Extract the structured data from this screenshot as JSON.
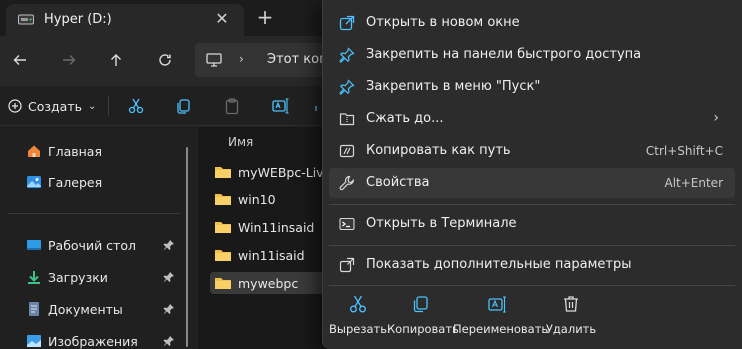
{
  "tab": {
    "title": "Hyper (D:)",
    "close_glyph": "✕",
    "new_glyph": "+"
  },
  "nav": {
    "back": "back-arrow-icon",
    "forward": "forward-arrow-icon",
    "up": "up-arrow-icon",
    "refresh": "refresh-icon"
  },
  "address": {
    "chevron": "›",
    "text": "Этот ком"
  },
  "commandbar": {
    "create_label": "Создать",
    "create_chevron": "⌄"
  },
  "sidebar": {
    "items": [
      {
        "label": "Главная",
        "icon": "home-icon"
      },
      {
        "label": "Галерея",
        "icon": "gallery-icon"
      },
      {
        "label": "Рабочий стол",
        "icon": "desktop-icon",
        "pinned": true
      },
      {
        "label": "Загрузки",
        "icon": "downloads-icon",
        "pinned": true
      },
      {
        "label": "Документы",
        "icon": "documents-icon",
        "pinned": true
      },
      {
        "label": "Изображения",
        "icon": "pictures-icon",
        "pinned": true
      }
    ]
  },
  "filelist": {
    "column_name": "Имя",
    "rows": [
      {
        "name": "myWEBpc-LiveC"
      },
      {
        "name": "win10"
      },
      {
        "name": "Win11insaid"
      },
      {
        "name": "win11isaid"
      },
      {
        "name": "mywebpc",
        "selected": true
      }
    ]
  },
  "context_menu": {
    "items": [
      {
        "label": "Открыть в новом окне",
        "icon": "open-new-window-icon",
        "shortcut": ""
      },
      {
        "label": "Закрепить на панели быстрого доступа",
        "icon": "pin-icon",
        "shortcut": ""
      },
      {
        "label": "Закрепить в меню \"Пуск\"",
        "icon": "pin-start-icon",
        "shortcut": ""
      },
      {
        "label": "Сжать до...",
        "icon": "zip-icon",
        "shortcut": "",
        "submenu_glyph": "›"
      },
      {
        "label": "Копировать как путь",
        "icon": "copy-path-icon",
        "shortcut": "Ctrl+Shift+C"
      },
      {
        "label": "Свойства",
        "icon": "wrench-icon",
        "shortcut": "Alt+Enter",
        "hover": true
      },
      {
        "label": "Открыть в Терминале",
        "icon": "terminal-icon",
        "shortcut": ""
      },
      {
        "label": "Показать дополнительные параметры",
        "icon": "more-options-icon",
        "shortcut": ""
      }
    ],
    "quick_actions": [
      {
        "label": "Вырезать",
        "icon": "cut-icon"
      },
      {
        "label": "Копировать",
        "icon": "copy-icon"
      },
      {
        "label": "Переименовать",
        "icon": "rename-icon"
      },
      {
        "label": "Удалить",
        "icon": "delete-icon"
      }
    ]
  },
  "colors": {
    "accent": "#4cc2ff",
    "folder": "#f2c04a",
    "menu_bg": "#2c2c2c",
    "window_bg": "#202020"
  }
}
